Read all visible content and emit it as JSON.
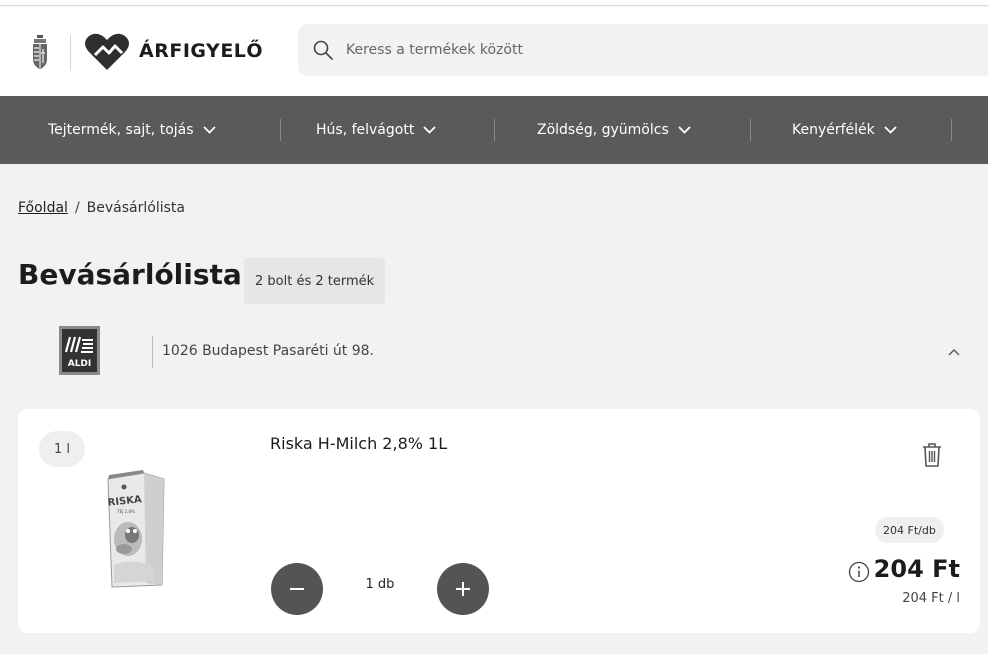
{
  "brand": {
    "name": "ÁRFIGYELŐ"
  },
  "search": {
    "placeholder": "Keress a termékek között"
  },
  "nav": {
    "items": [
      {
        "label": "Tejtermék, sajt, tojás"
      },
      {
        "label": "Hús, felvágott"
      },
      {
        "label": "Zöldség, gyümölcs"
      },
      {
        "label": "Kenyérfélék"
      }
    ]
  },
  "breadcrumb": {
    "home": "Főoldal",
    "separator": "/",
    "current": "Bevásárlólista"
  },
  "page": {
    "title": "Bevásárlólista",
    "summary": "2 bolt és 2 termék"
  },
  "store": {
    "name": "ALDI",
    "address": "1026 Budapest Pasaréti út 98."
  },
  "product": {
    "unit": "1 l",
    "name": "Riska H-Milch 2,8% 1L",
    "image_brand": "RISKA",
    "image_sub": "TEJ 2,8%",
    "quantity": "1 db",
    "unit_price": "204 Ft/db",
    "price": "204 Ft",
    "price_per_liter": "204 Ft / l"
  },
  "icons": {
    "crest": "hungarian-coat-of-arms-icon",
    "logo": "heart-logo-icon",
    "search": "search-icon",
    "chevron": "chevron-down-icon",
    "collapse": "chevron-up-icon",
    "trash": "trash-icon",
    "info": "info-icon"
  },
  "colors": {
    "nav_bg": "#5a5a5a",
    "button_bg": "#545454",
    "page_bg": "#f2f2f2"
  }
}
